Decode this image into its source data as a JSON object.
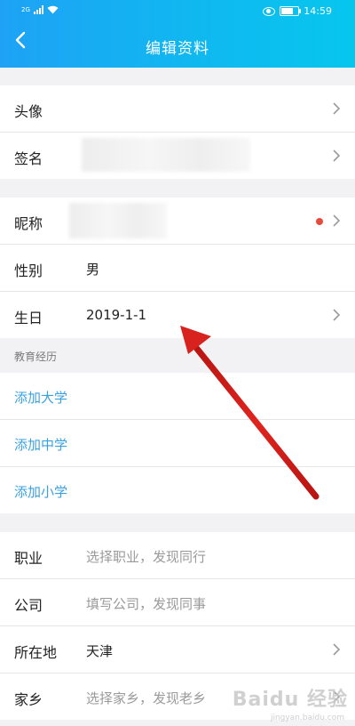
{
  "status_bar": {
    "time": "14:59",
    "network": "2G"
  },
  "header": {
    "title": "编辑资料"
  },
  "section1": [
    {
      "label": "头像"
    },
    {
      "label": "签名"
    }
  ],
  "section2": [
    {
      "label": "昵称"
    },
    {
      "label": "性别",
      "value": "男"
    },
    {
      "label": "生日",
      "value": "2019-1-1"
    }
  ],
  "education": {
    "heading": "教育经历",
    "links": [
      "添加大学",
      "添加中学",
      "添加小学"
    ]
  },
  "section4": [
    {
      "label": "职业",
      "hint": "选择职业，发现同行"
    },
    {
      "label": "公司",
      "hint": "填写公司，发现同事"
    },
    {
      "label": "所在地",
      "value": "天津"
    },
    {
      "label": "家乡",
      "hint": "选择家乡，发现老乡"
    }
  ],
  "watermark": {
    "text": "Baidu 经验",
    "url": "jingyan.baidu.com"
  },
  "colors": {
    "header_start": "#1ea2f5",
    "header_end": "#06c6ee",
    "link": "#3aa1e0",
    "dot": "#e34b3c",
    "arrow": "#d8221d"
  }
}
